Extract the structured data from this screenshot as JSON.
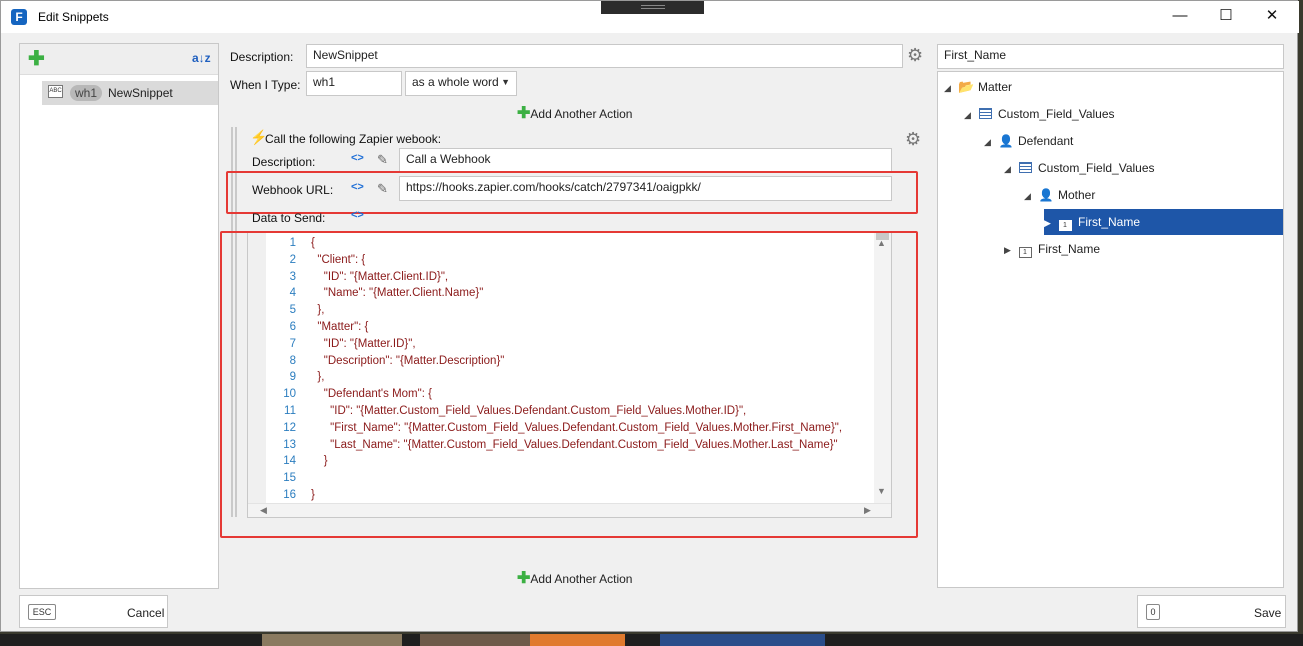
{
  "window": {
    "title": "Edit Snippets",
    "app_icon": "F",
    "minimize": "—",
    "maximize": "☐",
    "close": "✕"
  },
  "left_panel": {
    "add_icon": "plus-icon",
    "sort_icon": "sort-az-icon",
    "sort_glyph": "a↓z",
    "snippets": [
      {
        "shortcut": "wh1",
        "name": "NewSnippet",
        "icon_text": "ABC"
      }
    ]
  },
  "form": {
    "description_label": "Description:",
    "description_value": "NewSnippet",
    "when_label": "When I Type:",
    "when_value": "wh1",
    "match_mode": "as a whole word",
    "add_action_label": "Add Another Action"
  },
  "action": {
    "title": "Call the following Zapier webook:",
    "description_label": "Description:",
    "description_value": "Call a Webhook",
    "url_label": "Webhook URL:",
    "url_value": "https://hooks.zapier.com/hooks/catch/2797341/oaigpkk/",
    "data_label": "Data to Send:"
  },
  "code": {
    "lines": [
      {
        "n": "1",
        "text": "{"
      },
      {
        "n": "2",
        "text": "  \"Client\": {"
      },
      {
        "n": "3",
        "text": "    \"ID\": \"{Matter.Client.ID}\","
      },
      {
        "n": "4",
        "text": "    \"Name\": \"{Matter.Client.Name}\""
      },
      {
        "n": "5",
        "text": "  },"
      },
      {
        "n": "6",
        "text": "  \"Matter\": {"
      },
      {
        "n": "7",
        "text": "    \"ID\": \"{Matter.ID}\","
      },
      {
        "n": "8",
        "text": "    \"Description\": \"{Matter.Description}\""
      },
      {
        "n": "9",
        "text": "  },"
      },
      {
        "n": "10",
        "text": "    \"Defendant's Mom\": {"
      },
      {
        "n": "11",
        "text": "      \"ID\": \"{Matter.Custom_Field_Values.Defendant.Custom_Field_Values.Mother.ID}\","
      },
      {
        "n": "12",
        "text": "      \"First_Name\": \"{Matter.Custom_Field_Values.Defendant.Custom_Field_Values.Mother.First_Name}\","
      },
      {
        "n": "13",
        "text": "      \"Last_Name\": \"{Matter.Custom_Field_Values.Defendant.Custom_Field_Values.Mother.Last_Name}\""
      },
      {
        "n": "14",
        "text": "    }"
      },
      {
        "n": "15",
        "text": ""
      },
      {
        "n": "16",
        "text": "}"
      }
    ]
  },
  "right_panel": {
    "search_value": "First_Name",
    "tree": [
      {
        "label": "Matter",
        "arrow": "◢",
        "icon": "folder-open-icon"
      },
      {
        "label": "Custom_Field_Values",
        "arrow": "◢",
        "icon": "table-icon"
      },
      {
        "label": "Defendant",
        "arrow": "◢",
        "icon": "person-icon"
      },
      {
        "label": "Custom_Field_Values",
        "arrow": "◢",
        "icon": "table-icon"
      },
      {
        "label": "Mother",
        "arrow": "◢",
        "icon": "person-icon"
      },
      {
        "label": "First_Name",
        "arrow": "▶",
        "icon": "field-icon"
      },
      {
        "label": "First_Name",
        "arrow": "▶",
        "icon": "field-icon"
      }
    ]
  },
  "footer": {
    "cancel_key": "ESC",
    "cancel_label": "Cancel",
    "save_key": "0",
    "save_label": "Save"
  },
  "colors": {
    "selection": "#1e56a8",
    "highlight_box": "#e53935",
    "add_green": "#3cb043",
    "code_text": "#8b1a1a",
    "line_numbers": "#2b7dbf"
  }
}
